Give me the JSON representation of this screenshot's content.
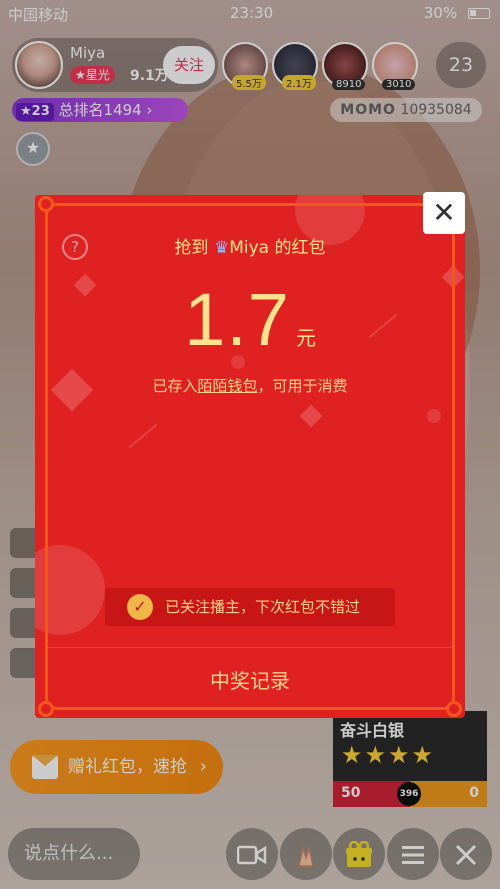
{
  "status_bar": {
    "carrier": "中国移动",
    "time": "23:30",
    "battery": "30%"
  },
  "host": {
    "name": "Miya",
    "badge": "★星光",
    "fans": "9.1万",
    "follow_label": "关注"
  },
  "viewers": [
    {
      "count": "5.5万"
    },
    {
      "count": "2.1万"
    },
    {
      "count": "8910"
    },
    {
      "count": "3010"
    }
  ],
  "viewer_total": "23",
  "rank": {
    "level": "★23",
    "label": "总排名1494 ›"
  },
  "momo": {
    "brand": "MOMO",
    "id": "10935084"
  },
  "gift_banner": {
    "label": "赠礼红包，速抢",
    "chevron": "›"
  },
  "game": {
    "title": "奋斗白银",
    "stars": "★★★★",
    "left_score": "50",
    "center_value": "396",
    "right_score": "0"
  },
  "chat": {
    "placeholder": "说点什么..."
  },
  "bottom_icons": [
    "video-camera-icon",
    "hands-icon",
    "gift-icon",
    "menu-icon",
    "close-icon"
  ],
  "modal": {
    "help": "?",
    "close": "✕",
    "title_prefix": "抢到 ",
    "title_host": "Miya",
    "title_suffix": " 的红包",
    "amount": "1.7",
    "unit": "元",
    "deposit_prefix": "已存入",
    "deposit_wallet": "陌陌钱包",
    "deposit_suffix": "，可用于消费",
    "followed_text": "已关注播主，下次红包不错过",
    "check": "✓",
    "records_label": "中奖记录"
  },
  "colors": {
    "modal_red": "#e02121",
    "gold": "#ffe28c",
    "follow_red": "#f0365e",
    "banner_orange": "#fd9a20"
  }
}
